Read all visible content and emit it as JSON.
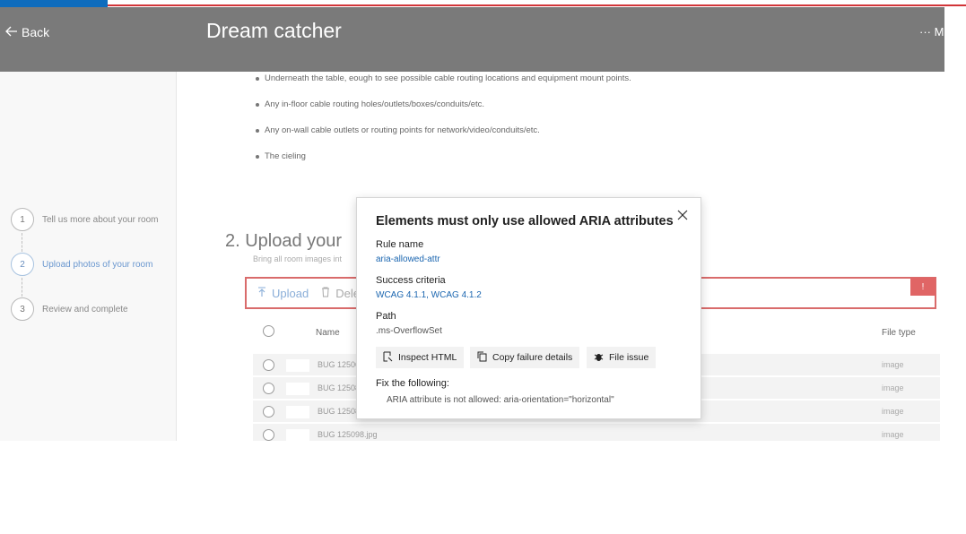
{
  "header": {
    "back_label": "Back",
    "title": "Dream catcher",
    "more_label": "··· M"
  },
  "steps": [
    {
      "number": "1",
      "label": "Tell us more about your room"
    },
    {
      "number": "2",
      "label": "Upload photos of your room"
    },
    {
      "number": "3",
      "label": "Review and complete"
    }
  ],
  "bullets": [
    "Underneath the table, eough to see possible cable routing locations and equipment mount points.",
    "Any in-floor cable routing holes/outlets/boxes/conduits/etc.",
    "Any on-wall cable outlets or routing points for network/video/conduits/etc.",
    "The cieling"
  ],
  "section": {
    "title": "2.  Upload your",
    "subtitle": "Bring all room images int"
  },
  "toolbar": {
    "upload_label": "Upload",
    "delete_label": "Dele",
    "alert_label": "!"
  },
  "table": {
    "col_name": "Name",
    "col_filetype": "File type",
    "rows": [
      {
        "name": "BUG 12506",
        "type": "image"
      },
      {
        "name": "BUG 12508",
        "type": "image"
      },
      {
        "name": "BUG 12508",
        "type": "image"
      },
      {
        "name": "BUG 125098.jpg",
        "type": "image"
      }
    ]
  },
  "popup": {
    "title": "Elements must only use allowed ARIA attributes",
    "rule_label": "Rule name",
    "rule_value": "aria-allowed-attr",
    "criteria_label": "Success criteria",
    "criteria_value": "WCAG 4.1.1, WCAG 4.1.2",
    "path_label": "Path",
    "path_value": ".ms-OverflowSet",
    "inspect_label": "Inspect HTML",
    "copy_label": "Copy failure details",
    "issue_label": "File issue",
    "fix_label": "Fix the following:",
    "fix_message": "ARIA attribute is not allowed: aria-orientation=\"horizontal\""
  },
  "colors": {
    "header_bg": "#7a7a7a",
    "accent_blue": "#1b66b0",
    "error_red": "#d96b6b"
  }
}
